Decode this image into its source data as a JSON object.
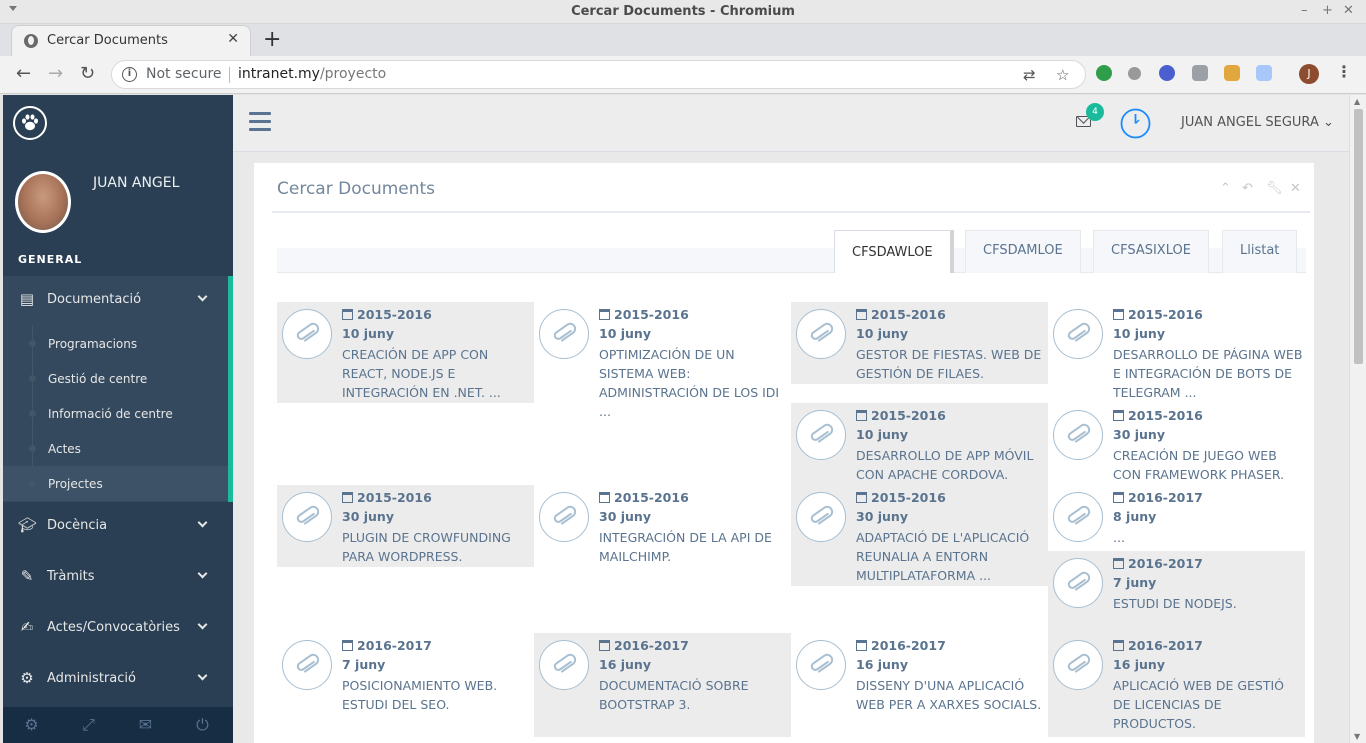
{
  "browser": {
    "window_title": "Cercar Documents - Chromium",
    "tab_title": "Cercar Documents",
    "new_tab": "+",
    "not_secure": "Not secure",
    "url_host": "intranet.my",
    "url_path": "/proyecto",
    "profile_initial": "J"
  },
  "sidebar": {
    "user_name": "JUAN ANGEL",
    "section": "GENERAL",
    "menu": [
      {
        "label": "Documentació",
        "icon": "book-icon"
      },
      {
        "label": "Docència",
        "icon": "graduation-cap-icon"
      },
      {
        "label": "Tràmits",
        "icon": "pencil-icon"
      },
      {
        "label": "Actes/Convocatòries",
        "icon": "edit-icon"
      },
      {
        "label": "Administració",
        "icon": "gears-icon"
      }
    ],
    "submenu": [
      "Programacions",
      "Gestió de centre",
      "Informació de centre",
      "Actes",
      "Projectes"
    ]
  },
  "topnav": {
    "mail_count": "4",
    "user": "JUAN ANGEL SEGURA"
  },
  "panel": {
    "title": "Cercar Documents",
    "tabs": [
      "CFSDAWLOE",
      "CFSDAMLOE",
      "CFSASIXLOE",
      "Llistat"
    ],
    "active_tab": "CFSDAWLOE"
  },
  "projects": [
    {
      "year": "2015-2016",
      "date": "10 juny",
      "text": "CREACIÓN DE APP CON REACT, NODE.JS E INTEGRACIÓN EN .NET. ..."
    },
    {
      "year": "2015-2016",
      "date": "10 juny",
      "text": "OPTIMIZACIÓN DE UN SISTEMA WEB: ADMINISTRACIÓN DE LOS IDI ..."
    },
    {
      "year": "2015-2016",
      "date": "10 juny",
      "text": "GESTOR DE FIESTAS. WEB DE GESTIÓN DE FILAES."
    },
    {
      "year": "2015-2016",
      "date": "10 juny",
      "text": "DESARROLLO DE PÁGINA WEB E INTEGRACIÓN DE BOTS DE TELEGRAM ..."
    },
    {
      "year": "2015-2016",
      "date": "10 juny",
      "text": "DESARROLLO DE APP MÓVIL CON APACHE CORDOVA."
    },
    {
      "year": "2015-2016",
      "date": "30 juny",
      "text": "CREACIÓN DE JUEGO WEB CON FRAMEWORK PHASER."
    },
    {
      "year": "2015-2016",
      "date": "30 juny",
      "text": "PLUGIN DE CROWFUNDING PARA WORDPRESS."
    },
    {
      "year": "2015-2016",
      "date": "30 juny",
      "text": "INTEGRACIÓN DE LA API DE MAILCHIMP."
    },
    {
      "year": "2015-2016",
      "date": "30 juny",
      "text": "ADAPTACIÓ DE L'APLICACIÓ REUNALIA A ENTORN MULTIPLATAFORMA ..."
    },
    {
      "year": "2016-2017",
      "date": "8 juny",
      "text": "..."
    },
    {
      "year": "2016-2017",
      "date": "7 juny",
      "text": "ESTUDI DE NODEJS."
    },
    {
      "year": "2016-2017",
      "date": "7 juny",
      "text": "POSICIONAMIENTO WEB. ESTUDI DEL SEO."
    },
    {
      "year": "2016-2017",
      "date": "16 juny",
      "text": "DOCUMENTACIÓ SOBRE BOOTSTRAP 3."
    },
    {
      "year": "2016-2017",
      "date": "16 juny",
      "text": "DISSENY D'UNA APLICACIÓ WEB PER A XARXES SOCIALS."
    },
    {
      "year": "2016-2017",
      "date": "16 juny",
      "text": "APLICACIÓ WEB DE GESTIÓ DE LICENCIAS DE PRODUCTOS."
    }
  ],
  "colors": {
    "sidebar": "#2a3f54",
    "accent": "#1abb9c",
    "text": "#5a738e"
  }
}
